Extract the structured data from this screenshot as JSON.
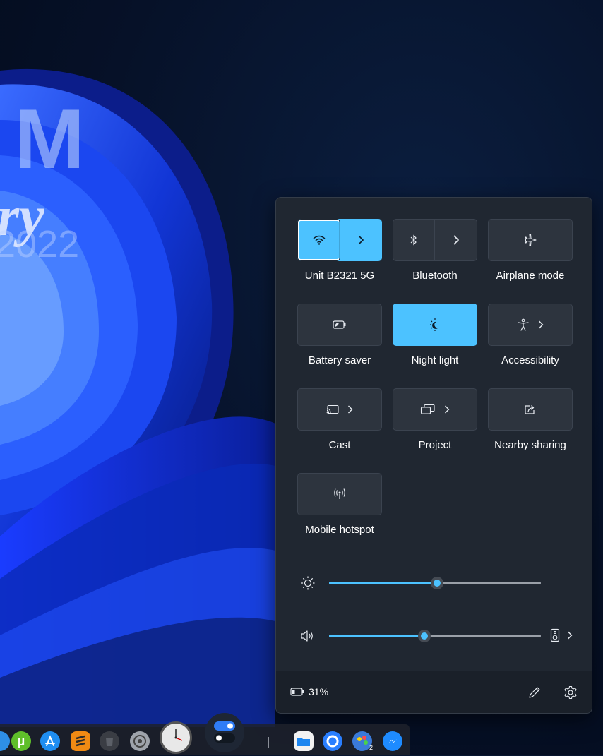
{
  "wallpaper": {
    "mark_letters": "M",
    "mark_script": "ry",
    "mark_year": "2022"
  },
  "quick_settings": {
    "tiles": [
      {
        "label": "Unit B2321 5G",
        "icon": "wifi-icon",
        "state": "on",
        "has_chevron": true
      },
      {
        "label": "Bluetooth",
        "icon": "bluetooth-icon",
        "state": "off",
        "has_chevron": true
      },
      {
        "label": "Airplane mode",
        "icon": "airplane-icon",
        "state": "off",
        "has_chevron": false
      },
      {
        "label": "Battery saver",
        "icon": "battery-saver-icon",
        "state": "off",
        "has_chevron": false
      },
      {
        "label": "Night light",
        "icon": "night-light-icon",
        "state": "on",
        "has_chevron": false
      },
      {
        "label": "Accessibility",
        "icon": "accessibility-icon",
        "state": "off",
        "has_chevron": true
      },
      {
        "label": "Cast",
        "icon": "cast-icon",
        "state": "off",
        "has_chevron": true
      },
      {
        "label": "Project",
        "icon": "project-icon",
        "state": "off",
        "has_chevron": true
      },
      {
        "label": "Nearby sharing",
        "icon": "share-icon",
        "state": "off",
        "has_chevron": false
      },
      {
        "label": "Mobile hotspot",
        "icon": "hotspot-icon",
        "state": "off",
        "has_chevron": false
      }
    ],
    "brightness": {
      "icon": "brightness-icon",
      "value_percent": 51
    },
    "volume": {
      "icon": "speaker-icon",
      "value_percent": 45,
      "output_icon": "speaker-device-icon"
    }
  },
  "footer": {
    "battery_percent_text": "31%",
    "battery_icon": "battery-icon",
    "edit_icon": "pencil-icon",
    "settings_icon": "gear-icon"
  },
  "colors": {
    "accent": "#4cc2ff",
    "panel": "#202731",
    "tile": "#2d343e"
  },
  "dock": {
    "icons": [
      "utorrent-icon",
      "app-store-icon",
      "sublime-icon",
      "trash-icon",
      "system-prefs-icon",
      "clock-icon",
      "toggle-app-icon",
      "files-icon",
      "edge-icon",
      "paint-icon",
      "messenger-icon"
    ],
    "paint_badge": "2"
  }
}
